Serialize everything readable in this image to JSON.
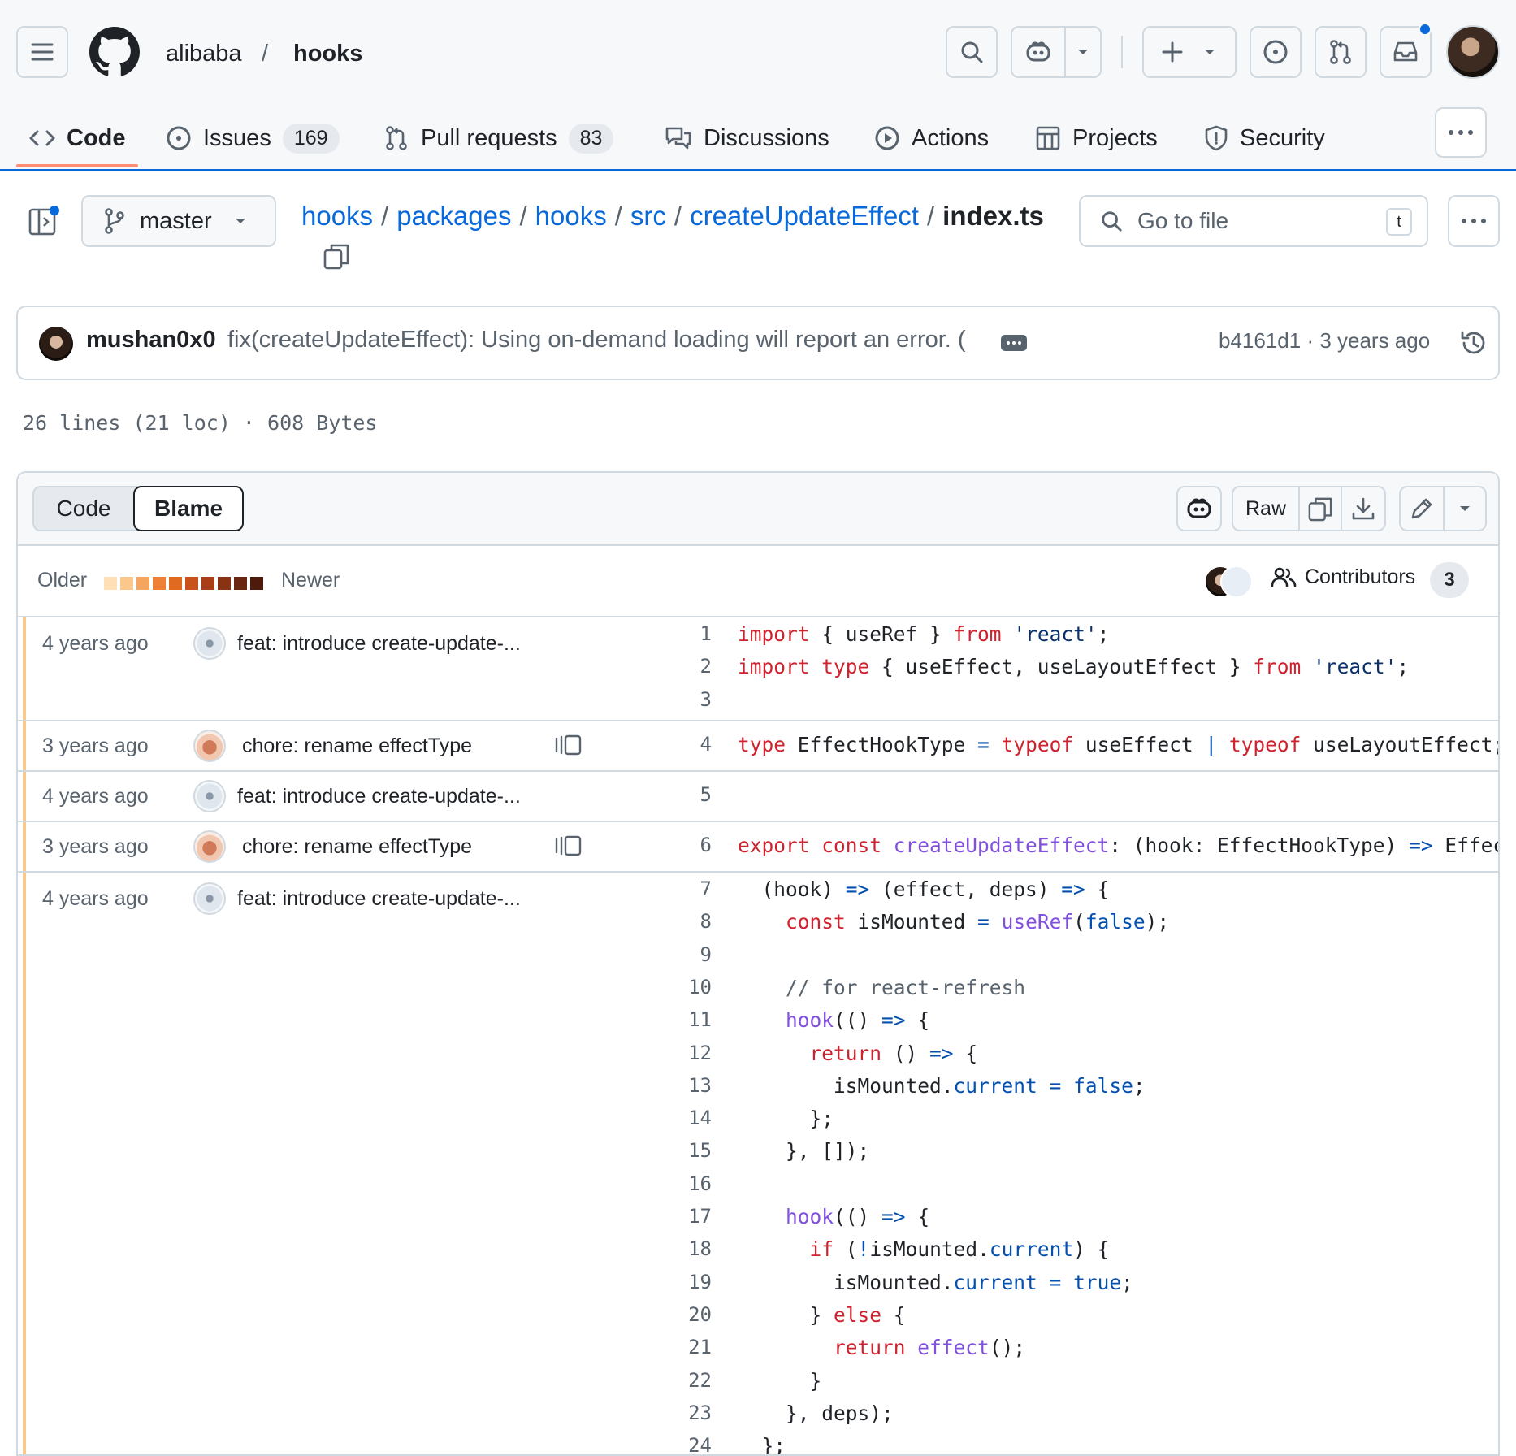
{
  "header": {
    "owner": "alibaba",
    "slash": "/",
    "repo": "hooks",
    "icons": [
      "menu-icon",
      "github-logo",
      "search-icon",
      "copilot-icon",
      "plus-icon",
      "issue-icon",
      "pull-request-icon",
      "inbox-icon"
    ]
  },
  "tabs": [
    {
      "label": "Code",
      "icon": "code-icon"
    },
    {
      "label": "Issues",
      "count": "169",
      "icon": "issue-icon"
    },
    {
      "label": "Pull requests",
      "count": "83",
      "icon": "pull-request-icon"
    },
    {
      "label": "Discussions",
      "icon": "discussion-icon"
    },
    {
      "label": "Actions",
      "icon": "play-icon"
    },
    {
      "label": "Projects",
      "icon": "table-icon"
    },
    {
      "label": "Security",
      "icon": "shield-icon"
    }
  ],
  "file_nav": {
    "branch": "master",
    "path": [
      "hooks",
      "packages",
      "hooks",
      "src",
      "createUpdateEffect"
    ],
    "separator": "/",
    "file": "index.ts",
    "goto_placeholder": "Go to file",
    "goto_shortcut": "t"
  },
  "commit": {
    "author": "mushan0x0",
    "message": "fix(createUpdateEffect): Using on-demand loading will report an error. (",
    "meta": "b4161d1 · 3 years ago"
  },
  "file_stats": "26 lines (21 loc) · 608 Bytes",
  "blame_toolbar": {
    "view_code": "Code",
    "view_blame": "Blame",
    "raw": "Raw",
    "legend_older": "Older",
    "legend_newer": "Newer",
    "legend_colors": [
      "#ffdfb6",
      "#fbc78b",
      "#f6a55f",
      "#ef8136",
      "#e06a1f",
      "#c9521a",
      "#a83f16",
      "#8a3214",
      "#6b2611",
      "#4d1a0c"
    ],
    "contributors_label": "Contributors",
    "contributors_count": "3"
  },
  "hunks": [
    {
      "age": "4 years ago",
      "message": "feat: introduce create-update-...",
      "avatar": "robot-avatar",
      "age_color": "#fbc78b",
      "reblame": false
    },
    {
      "age": "3 years ago",
      "message": "chore: rename effectType",
      "avatar": "orange-avatar",
      "age_color": "#fbc78b",
      "reblame": true
    },
    {
      "age": "4 years ago",
      "message": "feat: introduce create-update-...",
      "avatar": "robot-avatar",
      "age_color": "#fbc78b",
      "reblame": false
    },
    {
      "age": "3 years ago",
      "message": "chore: rename effectType",
      "avatar": "orange-avatar",
      "age_color": "#fbc78b",
      "reblame": true
    },
    {
      "age": "4 years ago",
      "message": "feat: introduce create-update-...",
      "avatar": "robot-avatar",
      "age_color": "#fbc78b",
      "reblame": false
    }
  ],
  "lines": [
    {
      "n": "1",
      "tokens": [
        [
          "k",
          "import"
        ],
        [
          "p",
          " { useRef } "
        ],
        [
          "k",
          "from"
        ],
        [
          "p",
          " "
        ],
        [
          "s",
          "'react'"
        ],
        [
          "p",
          ";"
        ]
      ]
    },
    {
      "n": "2",
      "tokens": [
        [
          "k",
          "import type"
        ],
        [
          "p",
          " { useEffect, useLayoutEffect } "
        ],
        [
          "k",
          "from"
        ],
        [
          "p",
          " "
        ],
        [
          "s",
          "'react'"
        ],
        [
          "p",
          ";"
        ]
      ]
    },
    {
      "n": "3",
      "tokens": []
    },
    {
      "n": "4",
      "tokens": [
        [
          "k",
          "type"
        ],
        [
          "p",
          " EffectHookType "
        ],
        [
          "o",
          "="
        ],
        [
          "p",
          " "
        ],
        [
          "k",
          "typeof"
        ],
        [
          "p",
          " useEffect "
        ],
        [
          "o",
          "|"
        ],
        [
          "p",
          " "
        ],
        [
          "k",
          "typeof"
        ],
        [
          "p",
          " useLayoutEffect;"
        ]
      ]
    },
    {
      "n": "5",
      "tokens": []
    },
    {
      "n": "6",
      "tokens": [
        [
          "k",
          "export const"
        ],
        [
          "p",
          " "
        ],
        [
          "f",
          "createUpdateEffect"
        ],
        [
          "p",
          ": (hook: EffectHookType) "
        ],
        [
          "o",
          "=>"
        ],
        [
          "p",
          " Effect"
        ]
      ]
    },
    {
      "n": "7",
      "tokens": [
        [
          "p",
          "  (hook) "
        ],
        [
          "o",
          "=>"
        ],
        [
          "p",
          " (effect, deps) "
        ],
        [
          "o",
          "=>"
        ],
        [
          "p",
          " {"
        ]
      ]
    },
    {
      "n": "8",
      "tokens": [
        [
          "p",
          "    "
        ],
        [
          "k",
          "const"
        ],
        [
          "p",
          " isMounted "
        ],
        [
          "o",
          "="
        ],
        [
          "p",
          " "
        ],
        [
          "f",
          "useRef"
        ],
        [
          "p",
          "("
        ],
        [
          "o",
          "false"
        ],
        [
          "p",
          ");"
        ]
      ]
    },
    {
      "n": "9",
      "tokens": []
    },
    {
      "n": "10",
      "tokens": [
        [
          "c",
          "    // for react-refresh"
        ]
      ]
    },
    {
      "n": "11",
      "tokens": [
        [
          "p",
          "    "
        ],
        [
          "f",
          "hook"
        ],
        [
          "p",
          "(() "
        ],
        [
          "o",
          "=>"
        ],
        [
          "p",
          " {"
        ]
      ]
    },
    {
      "n": "12",
      "tokens": [
        [
          "p",
          "      "
        ],
        [
          "k",
          "return"
        ],
        [
          "p",
          " () "
        ],
        [
          "o",
          "=>"
        ],
        [
          "p",
          " {"
        ]
      ]
    },
    {
      "n": "13",
      "tokens": [
        [
          "p",
          "        isMounted."
        ],
        [
          "o",
          "current"
        ],
        [
          "p",
          " "
        ],
        [
          "o",
          "="
        ],
        [
          "p",
          " "
        ],
        [
          "o",
          "false"
        ],
        [
          "p",
          ";"
        ]
      ]
    },
    {
      "n": "14",
      "tokens": [
        [
          "p",
          "      };"
        ]
      ]
    },
    {
      "n": "15",
      "tokens": [
        [
          "p",
          "    }, []);"
        ]
      ]
    },
    {
      "n": "16",
      "tokens": []
    },
    {
      "n": "17",
      "tokens": [
        [
          "p",
          "    "
        ],
        [
          "f",
          "hook"
        ],
        [
          "p",
          "(() "
        ],
        [
          "o",
          "=>"
        ],
        [
          "p",
          " {"
        ]
      ]
    },
    {
      "n": "18",
      "tokens": [
        [
          "p",
          "      "
        ],
        [
          "k",
          "if"
        ],
        [
          "p",
          " ("
        ],
        [
          "o",
          "!"
        ],
        [
          "p",
          "isMounted."
        ],
        [
          "o",
          "current"
        ],
        [
          "p",
          ") {"
        ]
      ]
    },
    {
      "n": "19",
      "tokens": [
        [
          "p",
          "        isMounted."
        ],
        [
          "o",
          "current"
        ],
        [
          "p",
          " "
        ],
        [
          "o",
          "="
        ],
        [
          "p",
          " "
        ],
        [
          "o",
          "true"
        ],
        [
          "p",
          ";"
        ]
      ]
    },
    {
      "n": "20",
      "tokens": [
        [
          "p",
          "      } "
        ],
        [
          "k",
          "else"
        ],
        [
          "p",
          " {"
        ]
      ]
    },
    {
      "n": "21",
      "tokens": [
        [
          "p",
          "        "
        ],
        [
          "k",
          "return"
        ],
        [
          "p",
          " "
        ],
        [
          "f",
          "effect"
        ],
        [
          "p",
          "();"
        ]
      ]
    },
    {
      "n": "22",
      "tokens": [
        [
          "p",
          "      }"
        ]
      ]
    },
    {
      "n": "23",
      "tokens": [
        [
          "p",
          "    }, deps);"
        ]
      ]
    },
    {
      "n": "24",
      "tokens": [
        [
          "p",
          "  };"
        ]
      ]
    }
  ]
}
